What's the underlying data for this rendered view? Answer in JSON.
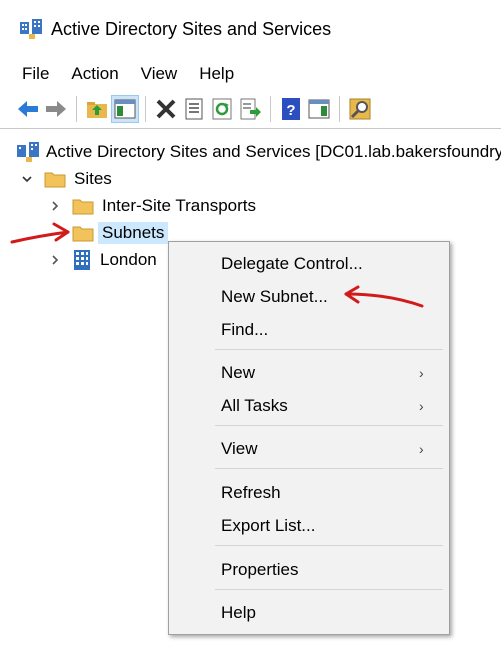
{
  "window": {
    "title": "Active Directory Sites and Services"
  },
  "menubar": {
    "items": [
      "File",
      "Action",
      "View",
      "Help"
    ]
  },
  "toolbar": {
    "icons": [
      "back-icon",
      "forward-icon",
      "up-folder-icon",
      "show-hide-console-tree-icon",
      "delete-icon",
      "properties-icon",
      "refresh-icon",
      "export-list-icon",
      "help-icon",
      "show-action-pane-icon",
      "find-icon"
    ]
  },
  "tree": {
    "root_label": "Active Directory Sites and Services [DC01.lab.bakersfoundry",
    "sites_label": "Sites",
    "inter_site_label": "Inter-Site Transports",
    "subnets_label": "Subnets",
    "london_label": "London"
  },
  "context_menu": {
    "delegate_control": "Delegate Control...",
    "new_subnet": "New Subnet...",
    "find": "Find...",
    "new": "New",
    "all_tasks": "All Tasks",
    "view": "View",
    "refresh": "Refresh",
    "export_list": "Export List...",
    "properties": "Properties",
    "help": "Help",
    "submenu_arrow": "›"
  },
  "colors": {
    "selection": "#cce8ff",
    "annotation": "#d11a1a",
    "folder": "#f2c35a"
  }
}
